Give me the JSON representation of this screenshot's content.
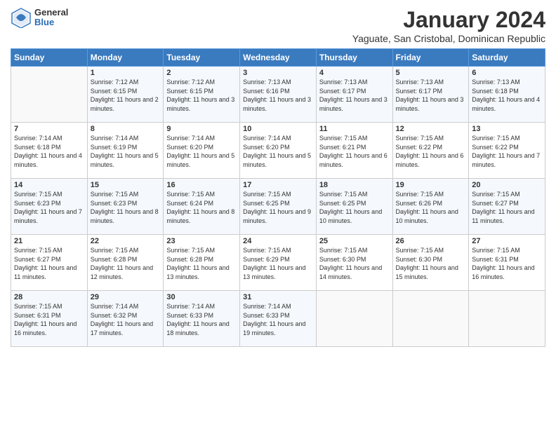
{
  "header": {
    "logo": {
      "general": "General",
      "blue": "Blue"
    },
    "title": "January 2024",
    "subtitle": "Yaguate, San Cristobal, Dominican Republic"
  },
  "weekdays": [
    "Sunday",
    "Monday",
    "Tuesday",
    "Wednesday",
    "Thursday",
    "Friday",
    "Saturday"
  ],
  "weeks": [
    [
      {
        "day": "",
        "sunrise": "",
        "sunset": "",
        "daylight": ""
      },
      {
        "day": "1",
        "sunrise": "Sunrise: 7:12 AM",
        "sunset": "Sunset: 6:15 PM",
        "daylight": "Daylight: 11 hours and 2 minutes."
      },
      {
        "day": "2",
        "sunrise": "Sunrise: 7:12 AM",
        "sunset": "Sunset: 6:15 PM",
        "daylight": "Daylight: 11 hours and 3 minutes."
      },
      {
        "day": "3",
        "sunrise": "Sunrise: 7:13 AM",
        "sunset": "Sunset: 6:16 PM",
        "daylight": "Daylight: 11 hours and 3 minutes."
      },
      {
        "day": "4",
        "sunrise": "Sunrise: 7:13 AM",
        "sunset": "Sunset: 6:17 PM",
        "daylight": "Daylight: 11 hours and 3 minutes."
      },
      {
        "day": "5",
        "sunrise": "Sunrise: 7:13 AM",
        "sunset": "Sunset: 6:17 PM",
        "daylight": "Daylight: 11 hours and 3 minutes."
      },
      {
        "day": "6",
        "sunrise": "Sunrise: 7:13 AM",
        "sunset": "Sunset: 6:18 PM",
        "daylight": "Daylight: 11 hours and 4 minutes."
      }
    ],
    [
      {
        "day": "7",
        "sunrise": "Sunrise: 7:14 AM",
        "sunset": "Sunset: 6:18 PM",
        "daylight": "Daylight: 11 hours and 4 minutes."
      },
      {
        "day": "8",
        "sunrise": "Sunrise: 7:14 AM",
        "sunset": "Sunset: 6:19 PM",
        "daylight": "Daylight: 11 hours and 5 minutes."
      },
      {
        "day": "9",
        "sunrise": "Sunrise: 7:14 AM",
        "sunset": "Sunset: 6:20 PM",
        "daylight": "Daylight: 11 hours and 5 minutes."
      },
      {
        "day": "10",
        "sunrise": "Sunrise: 7:14 AM",
        "sunset": "Sunset: 6:20 PM",
        "daylight": "Daylight: 11 hours and 5 minutes."
      },
      {
        "day": "11",
        "sunrise": "Sunrise: 7:15 AM",
        "sunset": "Sunset: 6:21 PM",
        "daylight": "Daylight: 11 hours and 6 minutes."
      },
      {
        "day": "12",
        "sunrise": "Sunrise: 7:15 AM",
        "sunset": "Sunset: 6:22 PM",
        "daylight": "Daylight: 11 hours and 6 minutes."
      },
      {
        "day": "13",
        "sunrise": "Sunrise: 7:15 AM",
        "sunset": "Sunset: 6:22 PM",
        "daylight": "Daylight: 11 hours and 7 minutes."
      }
    ],
    [
      {
        "day": "14",
        "sunrise": "Sunrise: 7:15 AM",
        "sunset": "Sunset: 6:23 PM",
        "daylight": "Daylight: 11 hours and 7 minutes."
      },
      {
        "day": "15",
        "sunrise": "Sunrise: 7:15 AM",
        "sunset": "Sunset: 6:23 PM",
        "daylight": "Daylight: 11 hours and 8 minutes."
      },
      {
        "day": "16",
        "sunrise": "Sunrise: 7:15 AM",
        "sunset": "Sunset: 6:24 PM",
        "daylight": "Daylight: 11 hours and 8 minutes."
      },
      {
        "day": "17",
        "sunrise": "Sunrise: 7:15 AM",
        "sunset": "Sunset: 6:25 PM",
        "daylight": "Daylight: 11 hours and 9 minutes."
      },
      {
        "day": "18",
        "sunrise": "Sunrise: 7:15 AM",
        "sunset": "Sunset: 6:25 PM",
        "daylight": "Daylight: 11 hours and 10 minutes."
      },
      {
        "day": "19",
        "sunrise": "Sunrise: 7:15 AM",
        "sunset": "Sunset: 6:26 PM",
        "daylight": "Daylight: 11 hours and 10 minutes."
      },
      {
        "day": "20",
        "sunrise": "Sunrise: 7:15 AM",
        "sunset": "Sunset: 6:27 PM",
        "daylight": "Daylight: 11 hours and 11 minutes."
      }
    ],
    [
      {
        "day": "21",
        "sunrise": "Sunrise: 7:15 AM",
        "sunset": "Sunset: 6:27 PM",
        "daylight": "Daylight: 11 hours and 11 minutes."
      },
      {
        "day": "22",
        "sunrise": "Sunrise: 7:15 AM",
        "sunset": "Sunset: 6:28 PM",
        "daylight": "Daylight: 11 hours and 12 minutes."
      },
      {
        "day": "23",
        "sunrise": "Sunrise: 7:15 AM",
        "sunset": "Sunset: 6:28 PM",
        "daylight": "Daylight: 11 hours and 13 minutes."
      },
      {
        "day": "24",
        "sunrise": "Sunrise: 7:15 AM",
        "sunset": "Sunset: 6:29 PM",
        "daylight": "Daylight: 11 hours and 13 minutes."
      },
      {
        "day": "25",
        "sunrise": "Sunrise: 7:15 AM",
        "sunset": "Sunset: 6:30 PM",
        "daylight": "Daylight: 11 hours and 14 minutes."
      },
      {
        "day": "26",
        "sunrise": "Sunrise: 7:15 AM",
        "sunset": "Sunset: 6:30 PM",
        "daylight": "Daylight: 11 hours and 15 minutes."
      },
      {
        "day": "27",
        "sunrise": "Sunrise: 7:15 AM",
        "sunset": "Sunset: 6:31 PM",
        "daylight": "Daylight: 11 hours and 16 minutes."
      }
    ],
    [
      {
        "day": "28",
        "sunrise": "Sunrise: 7:15 AM",
        "sunset": "Sunset: 6:31 PM",
        "daylight": "Daylight: 11 hours and 16 minutes."
      },
      {
        "day": "29",
        "sunrise": "Sunrise: 7:14 AM",
        "sunset": "Sunset: 6:32 PM",
        "daylight": "Daylight: 11 hours and 17 minutes."
      },
      {
        "day": "30",
        "sunrise": "Sunrise: 7:14 AM",
        "sunset": "Sunset: 6:33 PM",
        "daylight": "Daylight: 11 hours and 18 minutes."
      },
      {
        "day": "31",
        "sunrise": "Sunrise: 7:14 AM",
        "sunset": "Sunset: 6:33 PM",
        "daylight": "Daylight: 11 hours and 19 minutes."
      },
      {
        "day": "",
        "sunrise": "",
        "sunset": "",
        "daylight": ""
      },
      {
        "day": "",
        "sunrise": "",
        "sunset": "",
        "daylight": ""
      },
      {
        "day": "",
        "sunrise": "",
        "sunset": "",
        "daylight": ""
      }
    ]
  ]
}
